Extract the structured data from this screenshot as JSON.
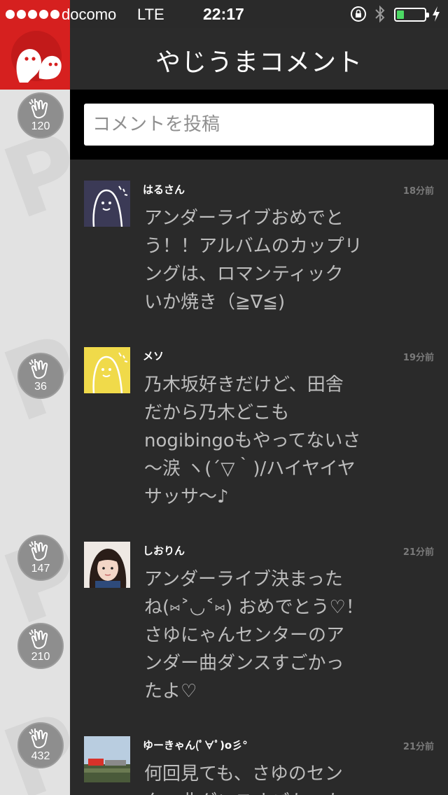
{
  "status_bar": {
    "carrier": "docomo",
    "network": "LTE",
    "time": "22:17",
    "battery_level": 0.25,
    "icons": [
      "orientation-lock-icon",
      "bluetooth-icon",
      "battery-icon",
      "charging-icon"
    ]
  },
  "header": {
    "title": "やじうまコメント",
    "logo_icon": "yajiuma-logo-icon"
  },
  "composer": {
    "placeholder": "コメントを投稿",
    "value": ""
  },
  "claps": [
    {
      "count": "120"
    },
    {
      "count": "36"
    },
    {
      "count": "147"
    },
    {
      "count": "210"
    },
    {
      "count": "432"
    }
  ],
  "comments": [
    {
      "user": "はるさん",
      "time": "18分前",
      "avatar": "ghost-avatar-dark",
      "lines": [
        "アンダーライブおめでと",
        "う！！アルバムのカップリ",
        "ングは、ロマンティック",
        "いか焼き（≧∇≦)"
      ]
    },
    {
      "user": "メソ",
      "time": "19分前",
      "avatar": "ghost-avatar-yellow",
      "lines": [
        "乃木坂好きだけど、田舎",
        "だから乃木どこも",
        "nogibingoもやってないさ",
        "〜涙 ヽ(´▽｀)/ハイヤイヤ",
        "サッサ〜♪"
      ]
    },
    {
      "user": "しおりん",
      "time": "21分前",
      "avatar": "photo-avatar-girl",
      "lines": [
        "アンダーライブ決まった",
        "ね(⑅˃◡˂⑅) おめでとう♡！",
        "さゆにゃんセンターのア",
        "ンダー曲ダンスすごかっ",
        "たよ♡"
      ]
    },
    {
      "user": "ゆーきゃん(ﾟ∀ﾟ)o彡°",
      "time": "21分前",
      "avatar": "photo-avatar-landscape",
      "lines": [
        "何回見ても、さゆのセン",
        "ター曲ダンスすごかった"
      ]
    }
  ],
  "colors": {
    "accent_red": "#d6201f",
    "battery_green": "#4cd964",
    "feed_bg": "#2a2a2a",
    "header_bg": "#2b2b2b"
  }
}
